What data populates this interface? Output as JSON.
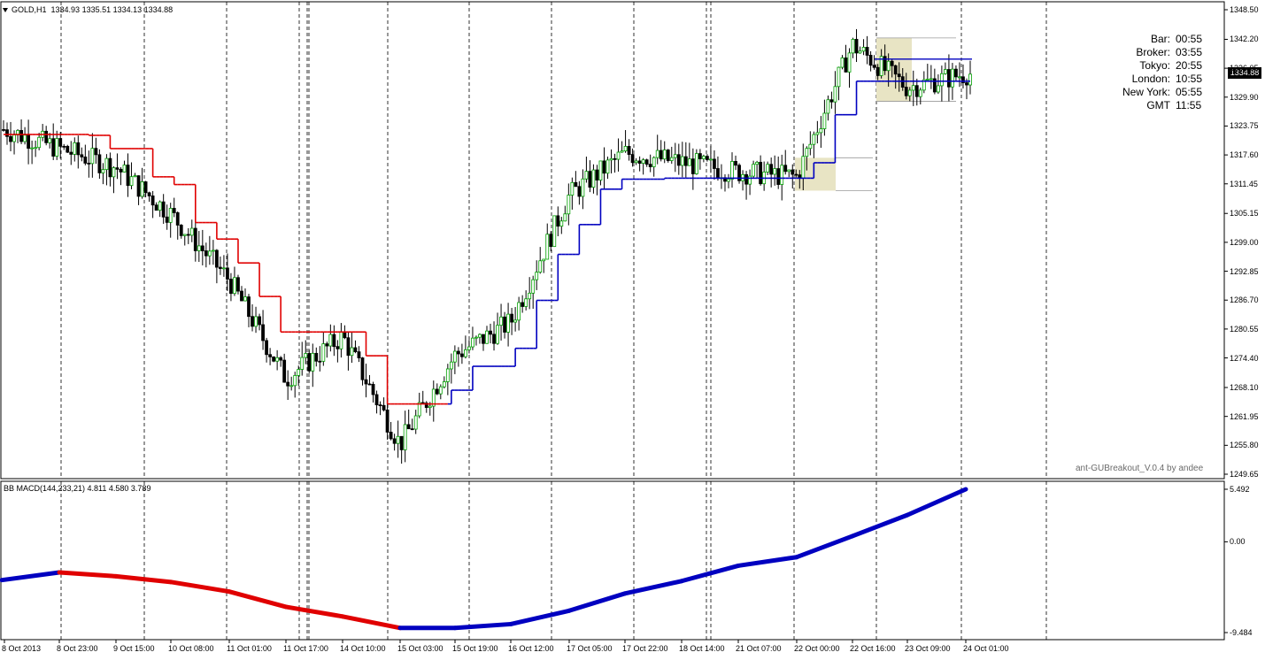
{
  "symbol_header": {
    "symbol": "GOLD,H1",
    "ohlc": "1334.93 1335.51 1334.13 1334.88"
  },
  "price_axis": {
    "ticks": [
      "1348.50",
      "1342.20",
      "1336.05",
      "1329.90",
      "1323.75",
      "1317.60",
      "1311.45",
      "1305.15",
      "1299.00",
      "1292.85",
      "1286.70",
      "1280.55",
      "1274.40",
      "1268.10",
      "1261.95",
      "1255.80",
      "1249.65"
    ],
    "current_price": "1334.88"
  },
  "time_axis": {
    "labels": [
      "8 Oct 2013",
      "8 Oct 23:00",
      "9 Oct 15:00",
      "10 Oct 08:00",
      "11 Oct 01:00",
      "11 Oct 17:00",
      "14 Oct 10:00",
      "15 Oct 03:00",
      "15 Oct 19:00",
      "16 Oct 12:00",
      "17 Oct 05:00",
      "17 Oct 22:00",
      "18 Oct 14:00",
      "21 Oct 07:00",
      "22 Oct 00:00",
      "22 Oct 16:00",
      "23 Oct 09:00",
      "24 Oct 01:00"
    ]
  },
  "session_clock": {
    "rows": [
      {
        "label": "Bar:",
        "value": "00:55"
      },
      {
        "label": "Broker:",
        "value": "03:55"
      },
      {
        "label": "Tokyo:",
        "value": "20:55"
      },
      {
        "label": "London:",
        "value": "10:55"
      },
      {
        "label": "New York:",
        "value": "05:55"
      },
      {
        "label": "GMT",
        "value": "11:55"
      }
    ]
  },
  "indicator_credit": "ant-GUBreakout_V.0.4 by andee",
  "macd_panel": {
    "title": "BB MACD(144,233,21) 4.811 4.580 3.789",
    "ticks": [
      "5.492",
      "0.00",
      "-9.484"
    ]
  },
  "colors": {
    "bull_candle": "#00a000",
    "bear_candle": "#000000",
    "stop_up": "#0000c0",
    "stop_down": "#e00000",
    "grid_separator": "#000000",
    "breakout_box": "#e8e4c4"
  },
  "chart_data": {
    "type": "line",
    "title": "GOLD,H1",
    "ylim": [
      1249.65,
      1348.5
    ],
    "x": [
      "8 Oct 2013",
      "8 Oct 23:00",
      "9 Oct 15:00",
      "10 Oct 08:00",
      "11 Oct 01:00",
      "11 Oct 17:00",
      "14 Oct 10:00",
      "15 Oct 03:00",
      "15 Oct 19:00",
      "16 Oct 12:00",
      "17 Oct 05:00",
      "17 Oct 22:00",
      "18 Oct 14:00",
      "21 Oct 07:00",
      "22 Oct 00:00",
      "22 Oct 16:00",
      "23 Oct 09:00",
      "24 Oct 01:00"
    ],
    "series": [
      {
        "values": [
          1323,
          1319,
          1315,
          1305,
          1291,
          1270,
          1279,
          1256,
          1275,
          1282,
          1309,
          1318,
          1316,
          1314,
          1313,
          1341,
          1332,
          1334.9
        ]
      }
    ]
  },
  "macd_data": {
    "type": "line",
    "ylim": [
      -9.484,
      5.492
    ],
    "x": [
      "8 Oct 2013",
      "8 Oct 23:00",
      "9 Oct 15:00",
      "10 Oct 08:00",
      "11 Oct 01:00",
      "11 Oct 17:00",
      "14 Oct 10:00",
      "15 Oct 03:00",
      "15 Oct 19:00",
      "16 Oct 12:00",
      "17 Oct 05:00",
      "17 Oct 22:00",
      "18 Oct 14:00",
      "21 Oct 07:00",
      "22 Oct 00:00",
      "22 Oct 16:00",
      "23 Oct 09:00",
      "24 Oct 01:00"
    ],
    "series": [
      {
        "values": [
          -4.0,
          -3.2,
          -3.6,
          -4.2,
          -5.2,
          -6.8,
          -7.8,
          -9.0,
          -9.0,
          -8.6,
          -7.2,
          -5.4,
          -4.1,
          -2.5,
          -1.6,
          0.6,
          2.8,
          5.49
        ]
      }
    ]
  }
}
